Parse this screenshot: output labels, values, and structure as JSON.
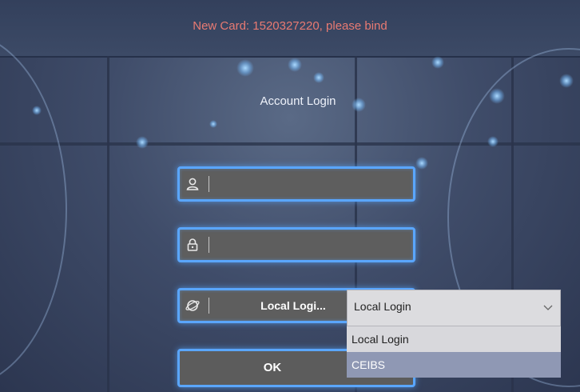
{
  "banner": {
    "text": "New Card: 1520327220, please bind",
    "color": "#e87a72"
  },
  "title": "Account Login",
  "username": {
    "value": "",
    "icon": "user-icon"
  },
  "password": {
    "value": "",
    "icon": "lock-icon"
  },
  "login_mode": {
    "label": "Local Logi...",
    "icon": "globe-icon"
  },
  "ok_label": "OK",
  "dropdown": {
    "selected": "Local Login",
    "options": [
      "Local Login",
      "CEIBS"
    ]
  },
  "colors": {
    "accent": "#5aa6ff",
    "field_bg": "#5e5e5e"
  }
}
